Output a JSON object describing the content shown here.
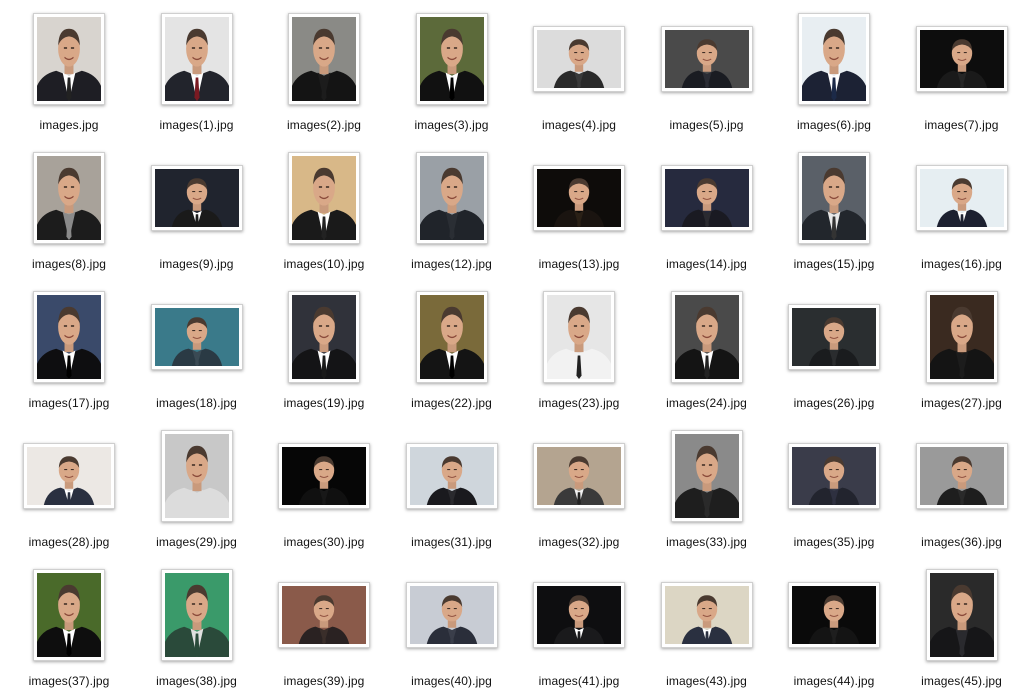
{
  "files": [
    {
      "name": "images.jpg",
      "thumb": "portrait",
      "bg": "#d8d4cf",
      "suit": "#1e1e24",
      "shirt": "#ffffff",
      "tie": "#222222"
    },
    {
      "name": "images(1).jpg",
      "thumb": "portrait",
      "bg": "#e4e4e4",
      "suit": "#22242c",
      "shirt": "#ffffff",
      "tie": "#7a1a22"
    },
    {
      "name": "images(2).jpg",
      "thumb": "portrait",
      "bg": "#8a8a86",
      "suit": "#141414",
      "shirt": "#1c1c1c",
      "tie": "#1c1c1c"
    },
    {
      "name": "images(3).jpg",
      "thumb": "portrait",
      "bg": "#5c6a3a",
      "suit": "#111111",
      "shirt": "#ffffff",
      "tie": "#000000"
    },
    {
      "name": "images(4).jpg",
      "thumb": "landscape",
      "bg": "#dcdcdc",
      "suit": "#2a2a2a",
      "shirt": "#3a3a3a",
      "tie": "#3a3a3a"
    },
    {
      "name": "images(5).jpg",
      "thumb": "landscape",
      "bg": "#4a4a4a",
      "suit": "#1a1c22",
      "shirt": "#2a2c34",
      "tie": "#2a2c34"
    },
    {
      "name": "images(6).jpg",
      "thumb": "portrait",
      "bg": "#e8eef2",
      "suit": "#1c2234",
      "shirt": "#ffffff",
      "tie": "#1c2a48"
    },
    {
      "name": "images(7).jpg",
      "thumb": "landscape",
      "bg": "#0d0d0d",
      "suit": "#1a1a1a",
      "shirt": "#262626",
      "tie": "#262626"
    },
    {
      "name": "images(8).jpg",
      "thumb": "portrait",
      "bg": "#a8a29a",
      "suit": "#1c1c1c",
      "shirt": "#8a8a8a",
      "tie": "#8a8a8a"
    },
    {
      "name": "images(9).jpg",
      "thumb": "landscape",
      "bg": "#20242e",
      "suit": "#1a1a1a",
      "shirt": "#ffffff",
      "tie": "#1a1a1a"
    },
    {
      "name": "images(10).jpg",
      "thumb": "portrait",
      "bg": "#d8b888",
      "suit": "#1a1a1a",
      "shirt": "#ffffff",
      "tie": "#222222"
    },
    {
      "name": "images(12).jpg",
      "thumb": "portrait",
      "bg": "#9aa0a6",
      "suit": "#20242a",
      "shirt": "#2a2e34",
      "tie": "#2a2e34"
    },
    {
      "name": "images(13).jpg",
      "thumb": "landscape",
      "bg": "#0e0c0a",
      "suit": "#1a1410",
      "shirt": "#2a2016",
      "tie": "#2a2016"
    },
    {
      "name": "images(14).jpg",
      "thumb": "landscape",
      "bg": "#262a3e",
      "suit": "#1a1a22",
      "shirt": "#2a2a30",
      "tie": "#2a2a30"
    },
    {
      "name": "images(15).jpg",
      "thumb": "portrait",
      "bg": "#5a6068",
      "suit": "#22262c",
      "shirt": "#e8e8e8",
      "tie": "#333333"
    },
    {
      "name": "images(16).jpg",
      "thumb": "landscape",
      "bg": "#e6eef2",
      "suit": "#1c2030",
      "shirt": "#ffffff",
      "tie": "#1c2030"
    },
    {
      "name": "images(17).jpg",
      "thumb": "portrait",
      "bg": "#3a4a6a",
      "suit": "#0e0e10",
      "shirt": "#ffffff",
      "tie": "#000000"
    },
    {
      "name": "images(18).jpg",
      "thumb": "landscape",
      "bg": "#3a7a8a",
      "suit": "#2a3a44",
      "shirt": "#3a4a54",
      "tie": "#3a4a54"
    },
    {
      "name": "images(19).jpg",
      "thumb": "portrait",
      "bg": "#30323a",
      "suit": "#141416",
      "shirt": "#ffffff",
      "tie": "#1a1a1a"
    },
    {
      "name": "images(22).jpg",
      "thumb": "portrait",
      "bg": "#7a6a3a",
      "suit": "#141414",
      "shirt": "#ffffff",
      "tie": "#000000"
    },
    {
      "name": "images(23).jpg",
      "thumb": "portrait",
      "bg": "#e6e6e6",
      "suit": "#f2f2f2",
      "shirt": "#f2f2f2",
      "tie": "#222222"
    },
    {
      "name": "images(24).jpg",
      "thumb": "portrait",
      "bg": "#4a4a4a",
      "suit": "#141414",
      "shirt": "#ffffff",
      "tie": "#222222"
    },
    {
      "name": "images(26).jpg",
      "thumb": "landscape",
      "bg": "#2a2e30",
      "suit": "#1a1c1e",
      "shirt": "#2a2c2e",
      "tie": "#2a2c2e"
    },
    {
      "name": "images(27).jpg",
      "thumb": "portrait",
      "bg": "#3a2a20",
      "suit": "#141414",
      "shirt": "#1c1c1c",
      "tie": "#1c1c1c"
    },
    {
      "name": "images(28).jpg",
      "thumb": "landscape",
      "bg": "#ece8e4",
      "suit": "#2a3040",
      "shirt": "#ffffff",
      "tie": "#2a3040"
    },
    {
      "name": "images(29).jpg",
      "thumb": "portrait",
      "bg": "#c8c8c8",
      "suit": "#dcdcdc",
      "shirt": "#dcdcdc",
      "tie": "#dcdcdc"
    },
    {
      "name": "images(30).jpg",
      "thumb": "landscape",
      "bg": "#060606",
      "suit": "#101010",
      "shirt": "#181818",
      "tie": "#181818"
    },
    {
      "name": "images(31).jpg",
      "thumb": "landscape",
      "bg": "#cfd6dc",
      "suit": "#1a1a1e",
      "shirt": "#2a2a2e",
      "tie": "#2a2a2e"
    },
    {
      "name": "images(32).jpg",
      "thumb": "landscape",
      "bg": "#b4a490",
      "suit": "#3a3a3a",
      "shirt": "#f0f0f0",
      "tie": "#222222"
    },
    {
      "name": "images(33).jpg",
      "thumb": "portrait",
      "bg": "#8a8a8a",
      "suit": "#1e1e1e",
      "shirt": "#2a2a2a",
      "tie": "#2a2a2a"
    },
    {
      "name": "images(35).jpg",
      "thumb": "landscape",
      "bg": "#3a3c4a",
      "suit": "#22242e",
      "shirt": "#2e3040",
      "tie": "#2e3040"
    },
    {
      "name": "images(36).jpg",
      "thumb": "landscape",
      "bg": "#9a9a9a",
      "suit": "#1e1e1e",
      "shirt": "#2a2a2a",
      "tie": "#2a2a2a"
    },
    {
      "name": "images(37).jpg",
      "thumb": "portrait",
      "bg": "#4a6a2a",
      "suit": "#0e0e0e",
      "shirt": "#ffffff",
      "tie": "#000000"
    },
    {
      "name": "images(38).jpg",
      "thumb": "portrait",
      "bg": "#3a9a6a",
      "suit": "#2a4a3a",
      "shirt": "#e0e0e0",
      "tie": "#2a4a3a"
    },
    {
      "name": "images(39).jpg",
      "thumb": "landscape",
      "bg": "#8a5a4a",
      "suit": "#2a2222",
      "shirt": "#3a2e2a",
      "tie": "#3a2e2a"
    },
    {
      "name": "images(40).jpg",
      "thumb": "landscape",
      "bg": "#c8ccd4",
      "suit": "#2a2e3a",
      "shirt": "#3a3e4a",
      "tie": "#3a3e4a"
    },
    {
      "name": "images(41).jpg",
      "thumb": "landscape",
      "bg": "#0e0e10",
      "suit": "#1a1a1c",
      "shirt": "#ffffff",
      "tie": "#1a1a1c"
    },
    {
      "name": "images(43).jpg",
      "thumb": "landscape",
      "bg": "#dcd6c4",
      "suit": "#2a3040",
      "shirt": "#ffffff",
      "tie": "#2a3040"
    },
    {
      "name": "images(44).jpg",
      "thumb": "landscape",
      "bg": "#0a0a0a",
      "suit": "#141414",
      "shirt": "#1e1e1e",
      "tie": "#1e1e1e"
    },
    {
      "name": "images(45).jpg",
      "thumb": "portrait",
      "bg": "#2a2a2a",
      "suit": "#161618",
      "shirt": "#2a2a2e",
      "tie": "#2a2a2e"
    }
  ]
}
